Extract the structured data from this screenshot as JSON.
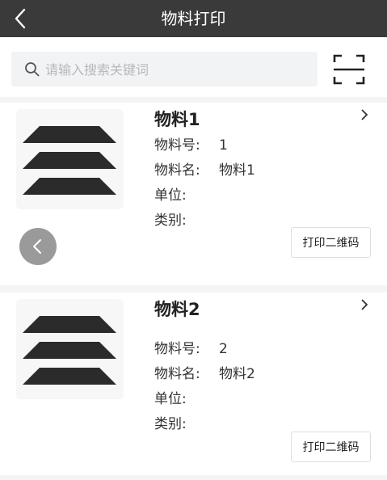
{
  "header": {
    "title": "物料打印",
    "back_icon": "chevron-left-icon"
  },
  "search": {
    "placeholder": "请输入搜索关键词",
    "value": "",
    "scan_icon": "scan-icon"
  },
  "labels": {
    "number": "物料号:",
    "name": "物料名:",
    "unit": "单位:",
    "category": "类别:"
  },
  "items": [
    {
      "title": "物料1",
      "number": "1",
      "name": "物料1",
      "unit": "",
      "category": "",
      "print_label": "打印二维码"
    },
    {
      "title": "物料2",
      "number": "2",
      "name": "物料2",
      "unit": "",
      "category": "",
      "print_label": "打印二维码"
    }
  ],
  "colors": {
    "header_bg": "#3a3a3a",
    "page_bg": "#f4f4f4",
    "float_button": "#9a9a9a"
  }
}
